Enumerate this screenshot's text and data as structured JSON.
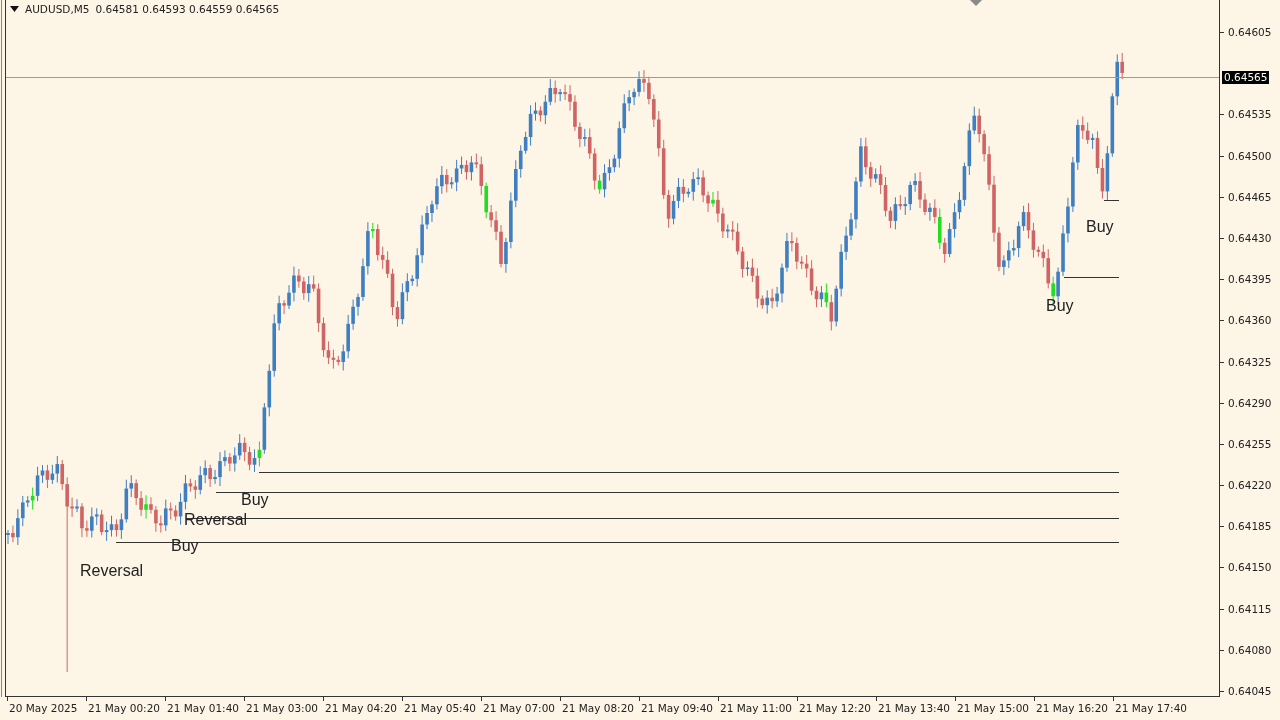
{
  "header": {
    "symbol": "AUDUSD,M5",
    "quote": "0.64581 0.64593 0.64559 0.64565"
  },
  "price_axis": [
    "0.64605",
    "0.64535",
    "0.64500",
    "0.64465",
    "0.64430",
    "0.64395",
    "0.64360",
    "0.64325",
    "0.64290",
    "0.64255",
    "0.64220",
    "0.64185",
    "0.64150",
    "0.64115",
    "0.64080",
    "0.64045"
  ],
  "current_price": "0.64565",
  "time_axis": [
    "20 May 2025",
    "21 May 00:20",
    "21 May 01:40",
    "21 May 03:00",
    "21 May 04:20",
    "21 May 05:40",
    "21 May 07:00",
    "21 May 08:20",
    "21 May 09:40",
    "21 May 11:00",
    "21 May 12:20",
    "21 May 13:40",
    "21 May 15:00",
    "21 May 16:20",
    "21 May 17:40"
  ],
  "signal_labels": [
    "Buy",
    "Reversal",
    "Buy",
    "Reversal",
    "Buy",
    "Buy"
  ]
}
